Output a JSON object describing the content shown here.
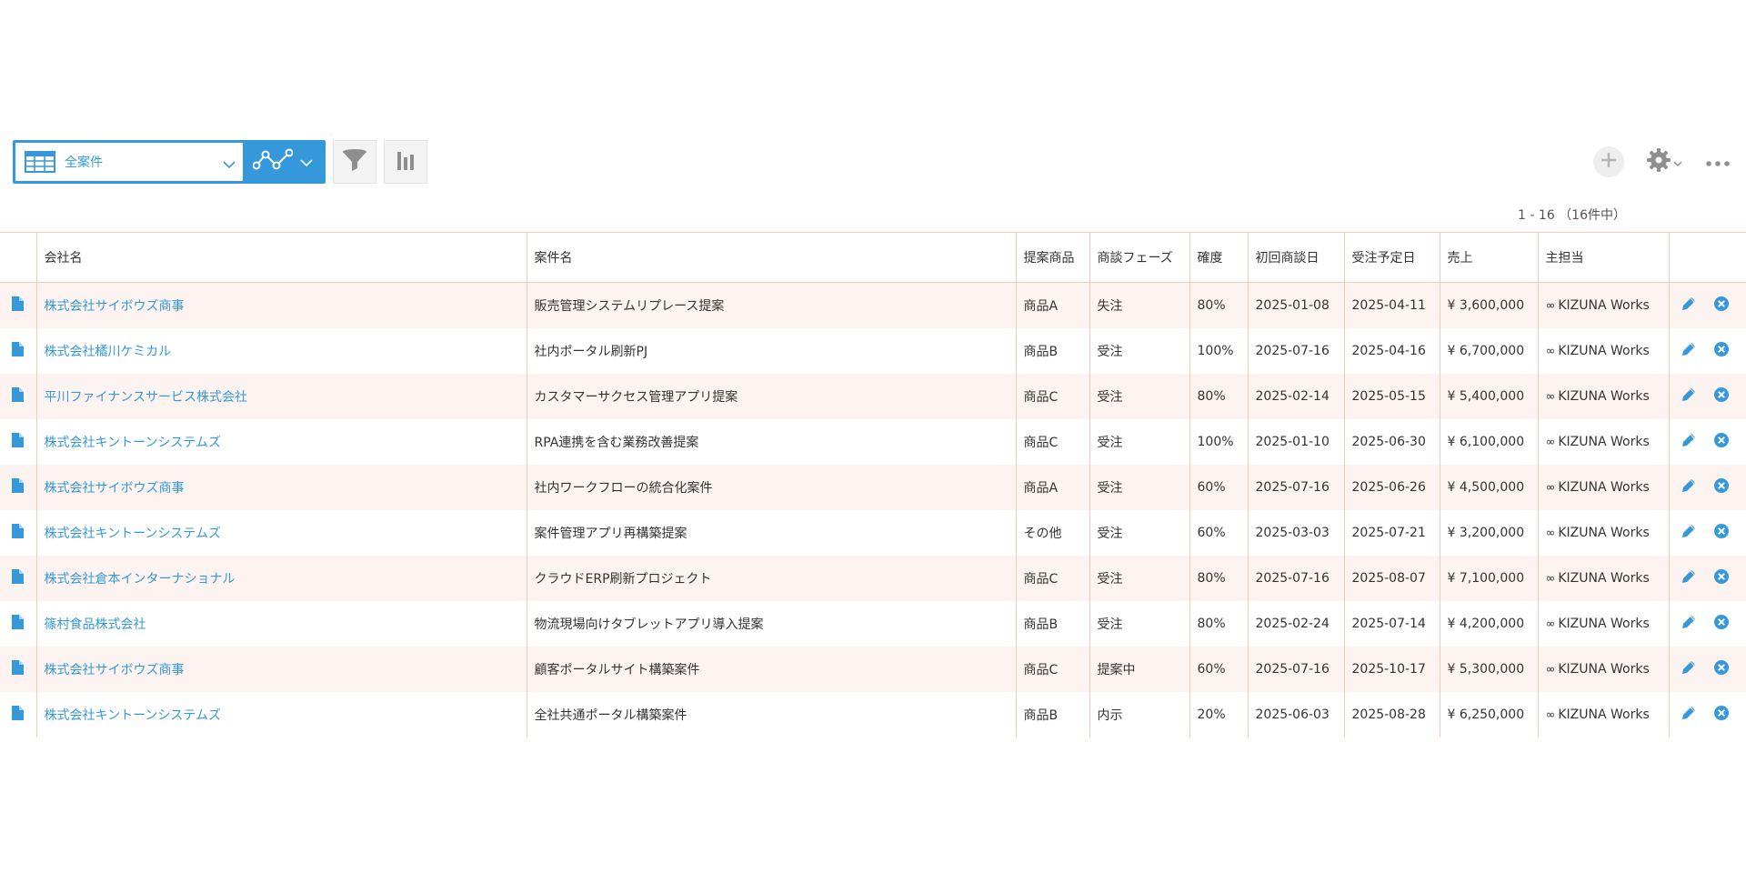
{
  "toolbar": {
    "view_name": "全案件",
    "view_icon": "table-icon",
    "graph_icon": "graph-icon",
    "filter_icon": "funnel-icon",
    "chart_icon": "bar-chart-icon",
    "add_icon": "plus-icon",
    "settings_icon": "gear-icon",
    "more_icon": "more-icon"
  },
  "pager": "1 - 16 （16件中）",
  "table": {
    "headers": [
      "会社名",
      "案件名",
      "提案商品",
      "商談フェーズ",
      "確度",
      "初回商談日",
      "受注予定日",
      "売上",
      "主担当"
    ],
    "rows": [
      {
        "company": "株式会社サイボウズ商事",
        "project": "販売管理システムリプレース提案",
        "product": "商品A",
        "phase": "失注",
        "probability": "80%",
        "first_meeting": "2025-01-08",
        "order_date": "2025-04-11",
        "sales": "¥ 3,600,000",
        "owner": "KIZUNA Works"
      },
      {
        "company": "株式会社橘川ケミカル",
        "project": "社内ポータル刷新PJ",
        "product": "商品B",
        "phase": "受注",
        "probability": "100%",
        "first_meeting": "2025-07-16",
        "order_date": "2025-04-16",
        "sales": "¥ 6,700,000",
        "owner": "KIZUNA Works"
      },
      {
        "company": "平川ファイナンスサービス株式会社",
        "project": "カスタマーサクセス管理アプリ提案",
        "product": "商品C",
        "phase": "受注",
        "probability": "80%",
        "first_meeting": "2025-02-14",
        "order_date": "2025-05-15",
        "sales": "¥ 5,400,000",
        "owner": "KIZUNA Works"
      },
      {
        "company": "株式会社キントーンシステムズ",
        "project": "RPA連携を含む業務改善提案",
        "product": "商品C",
        "phase": "受注",
        "probability": "100%",
        "first_meeting": "2025-01-10",
        "order_date": "2025-06-30",
        "sales": "¥ 6,100,000",
        "owner": "KIZUNA Works"
      },
      {
        "company": "株式会社サイボウズ商事",
        "project": "社内ワークフローの統合化案件",
        "product": "商品A",
        "phase": "受注",
        "probability": "60%",
        "first_meeting": "2025-07-16",
        "order_date": "2025-06-26",
        "sales": "¥ 4,500,000",
        "owner": "KIZUNA Works"
      },
      {
        "company": "株式会社キントーンシステムズ",
        "project": "案件管理アプリ再構築提案",
        "product": "その他",
        "phase": "受注",
        "probability": "60%",
        "first_meeting": "2025-03-03",
        "order_date": "2025-07-21",
        "sales": "¥ 3,200,000",
        "owner": "KIZUNA Works"
      },
      {
        "company": "株式会社倉本インターナショナル",
        "project": "クラウドERP刷新プロジェクト",
        "product": "商品C",
        "phase": "受注",
        "probability": "80%",
        "first_meeting": "2025-07-16",
        "order_date": "2025-08-07",
        "sales": "¥ 7,100,000",
        "owner": "KIZUNA Works"
      },
      {
        "company": "篠村食品株式会社",
        "project": "物流現場向けタブレットアプリ導入提案",
        "product": "商品B",
        "phase": "受注",
        "probability": "80%",
        "first_meeting": "2025-02-24",
        "order_date": "2025-07-14",
        "sales": "¥ 4,200,000",
        "owner": "KIZUNA Works"
      },
      {
        "company": "株式会社サイボウズ商事",
        "project": "顧客ポータルサイト構築案件",
        "product": "商品C",
        "phase": "提案中",
        "probability": "60%",
        "first_meeting": "2025-07-16",
        "order_date": "2025-10-17",
        "sales": "¥ 5,300,000",
        "owner": "KIZUNA Works"
      },
      {
        "company": "株式会社キントーンシステムズ",
        "project": "全社共通ポータル構築案件",
        "product": "商品B",
        "phase": "内示",
        "probability": "20%",
        "first_meeting": "2025-06-03",
        "order_date": "2025-08-28",
        "sales": "¥ 6,250,000",
        "owner": "KIZUNA Works"
      }
    ]
  },
  "colors": {
    "accent": "#3498db",
    "row_stripe": "#fdf4f2",
    "border": "#f1c9bd"
  }
}
